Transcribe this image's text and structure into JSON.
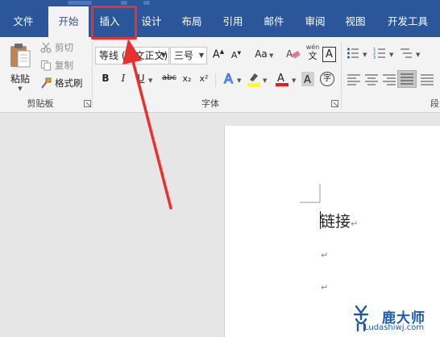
{
  "tabs": [
    {
      "label": "文件",
      "active": false
    },
    {
      "label": "开始",
      "active": true
    },
    {
      "label": "插入",
      "active": false
    },
    {
      "label": "设计",
      "active": false
    },
    {
      "label": "布局",
      "active": false
    },
    {
      "label": "引用",
      "active": false
    },
    {
      "label": "邮件",
      "active": false
    },
    {
      "label": "审阅",
      "active": false
    },
    {
      "label": "视图",
      "active": false
    },
    {
      "label": "开发工具",
      "active": false
    }
  ],
  "clipboard": {
    "paste_label": "粘贴",
    "cut_label": "剪切",
    "copy_label": "复制",
    "format_painter_label": "格式刷",
    "group_label": "剪贴板"
  },
  "font": {
    "font_name": "等线 (中文正文)",
    "font_size": "三号",
    "wen_label": "wén",
    "wen_char": "文",
    "a_box": "A",
    "case_label": "Aa",
    "strike_label": "abc",
    "sub_label": "x₂",
    "sup_label": "x²",
    "circle_char": "字",
    "group_label": "字体"
  },
  "paragraph": {
    "group_label": "段"
  },
  "document": {
    "text": "链接",
    "para_mark": "↵"
  },
  "watermark": {
    "title": "鹿大师",
    "url": "Ludashiwj.com"
  },
  "colors": {
    "tab_bar": "#2b579a",
    "ribbon": "#f3f3f3",
    "annotation": "#e8302f",
    "highlight_yellow": "#ffff00",
    "font_red": "#e02020"
  }
}
